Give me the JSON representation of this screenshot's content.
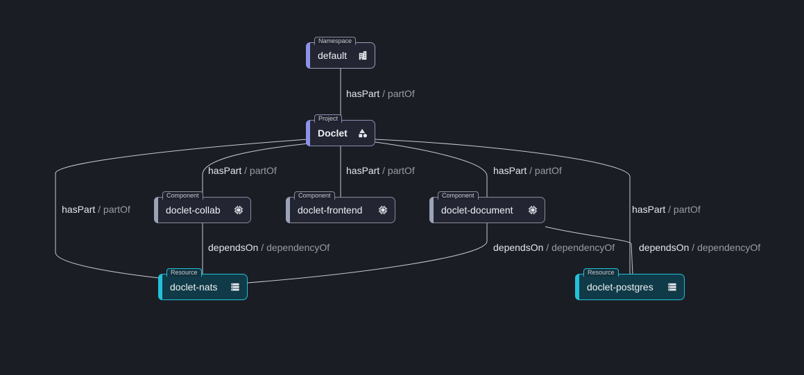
{
  "nodes": {
    "default": {
      "type": "Namespace",
      "label": "default"
    },
    "doclet": {
      "type": "Project",
      "label": "Doclet"
    },
    "collab": {
      "type": "Component",
      "label": "doclet-collab"
    },
    "frontend": {
      "type": "Component",
      "label": "doclet-frontend"
    },
    "document": {
      "type": "Component",
      "label": "doclet-document"
    },
    "nats": {
      "type": "Resource",
      "label": "doclet-nats"
    },
    "postgres": {
      "type": "Resource",
      "label": "doclet-postgres"
    }
  },
  "edges": {
    "default_project": {
      "rel": "hasPart",
      "inv": "partOf"
    },
    "project_collab": {
      "rel": "hasPart",
      "inv": "partOf"
    },
    "project_frontend": {
      "rel": "hasPart",
      "inv": "partOf"
    },
    "project_document": {
      "rel": "hasPart",
      "inv": "partOf"
    },
    "project_nats": {
      "rel": "hasPart",
      "inv": "partOf"
    },
    "project_postgres": {
      "rel": "hasPart",
      "inv": "partOf"
    },
    "collab_nats": {
      "rel": "dependsOn",
      "inv": "dependencyOf"
    },
    "document_nats": {
      "rel": "dependsOn",
      "inv": "dependencyOf"
    },
    "document_postgres": {
      "rel": "dependsOn",
      "inv": "dependencyOf"
    }
  },
  "separator": "/",
  "icons": {
    "namespace": "building-icon",
    "project": "shapes-icon",
    "component": "chip-icon",
    "resource": "server-icon"
  },
  "colors": {
    "background": "#1b1d25",
    "namespace_accent": "#8c94ea",
    "project_accent": "#8c94ea",
    "component_accent": "#9aa3b8",
    "resource_accent": "#22c1d9"
  }
}
